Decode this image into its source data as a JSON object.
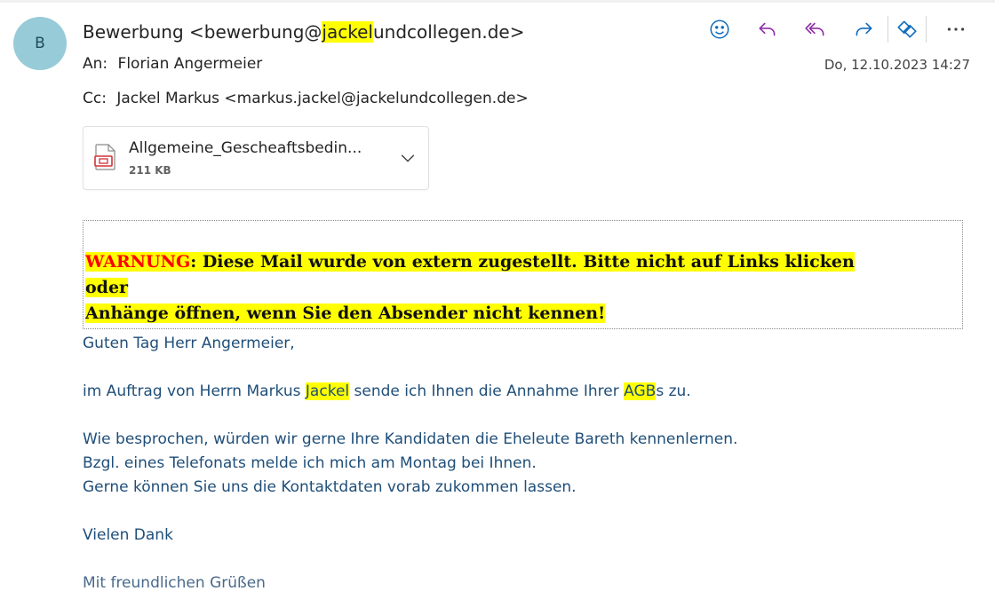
{
  "sender": {
    "initial": "B",
    "name": "Bewerbung",
    "email_prefix": "bewerbung@",
    "email_highlight": "jackel",
    "email_suffix": "undcollegen.de"
  },
  "recipients": {
    "to_label": "An:",
    "to": "Florian Angermeier",
    "cc_label": "Cc:",
    "cc": "Jackel Markus <markus.jackel@jackelundcollegen.de>"
  },
  "date": "Do, 12.10.2023 14:27",
  "toolbar": {
    "icons": [
      "emoji-icon",
      "reply-icon",
      "reply-all-icon",
      "forward-icon",
      "loop-icon",
      "more-icon"
    ]
  },
  "attachment": {
    "name": "Allgemeine_Gescheaftsbedin...",
    "size": "211 KB"
  },
  "warning": {
    "keyword": "WARNUNG",
    "line1": ": Diese Mail wurde von extern zugestellt. Bitte nicht auf Links klicken oder",
    "line2": "Anhänge öffnen, wenn Sie den Absender nicht kennen!"
  },
  "body": {
    "greeting": "Guten Tag Herr Angermeier,",
    "p1_a": "im Auftrag von Herrn Markus ",
    "p1_hl1": "Jackel",
    "p1_b": " sende ich Ihnen die Annahme Ihrer ",
    "p1_hl2": "AGB",
    "p1_c": "s zu.",
    "p2_l1": "Wie besprochen, würden wir gerne Ihre Kandidaten die Eheleute Bareth kennenlernen.",
    "p2_l2": "Bzgl. eines Telefonats melde ich mich am Montag bei Ihnen.",
    "p2_l3": "Gerne können Sie uns die Kontaktdaten vorab zukommen lassen.",
    "thanks": "Vielen Dank",
    "closing": "Mit freundlichen Grüßen"
  },
  "colors": {
    "highlight": "#ffff00",
    "warning_red": "#ff0000",
    "body_text": "#1f4e79",
    "toolbar_blue": "#0f6cbd",
    "toolbar_purple": "#8e2ca8"
  }
}
